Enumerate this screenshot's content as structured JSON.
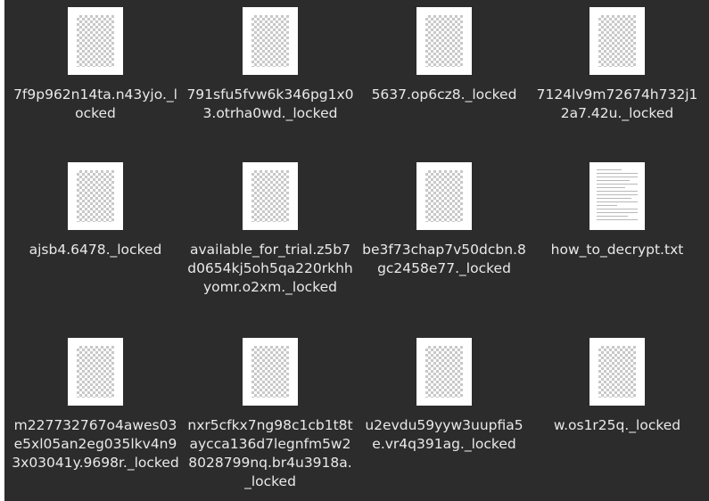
{
  "file_view": {
    "items": [
      {
        "name": "7f9p962n14ta.n43yjo._locked",
        "icon": "image-file-icon"
      },
      {
        "name": "791sfu5fvw6k346pg1x03.otrha0wd._locked",
        "icon": "image-file-icon"
      },
      {
        "name": "5637.op6cz8._locked",
        "icon": "image-file-icon"
      },
      {
        "name": "7124lv9m72674h732j12a7.42u._locked",
        "icon": "image-file-icon"
      },
      {
        "name": "ajsb4.6478._locked",
        "icon": "image-file-icon"
      },
      {
        "name": "available_for_trial.z5b7d0654kj5oh5qa220rkhhyomr.o2xm._locked",
        "icon": "image-file-icon"
      },
      {
        "name": "be3f73chap7v50dcbn.8gc2458e77._locked",
        "icon": "image-file-icon"
      },
      {
        "name": "how_to_decrypt.txt",
        "icon": "text-file-icon"
      },
      {
        "name": "m227732767o4awes03e5xl05an2eg035lkv4n93x03041y.9698r._locked",
        "icon": "image-file-icon"
      },
      {
        "name": "nxr5cfkx7ng98c1cb1t8taycca136d7legnfm5w28028799nq.br4u3918a._locked",
        "icon": "image-file-icon"
      },
      {
        "name": "u2evdu59yyw3uupfia5e.vr4q391ag._locked",
        "icon": "image-file-icon"
      },
      {
        "name": "w.os1r25q._locked",
        "icon": "image-file-icon"
      }
    ]
  }
}
